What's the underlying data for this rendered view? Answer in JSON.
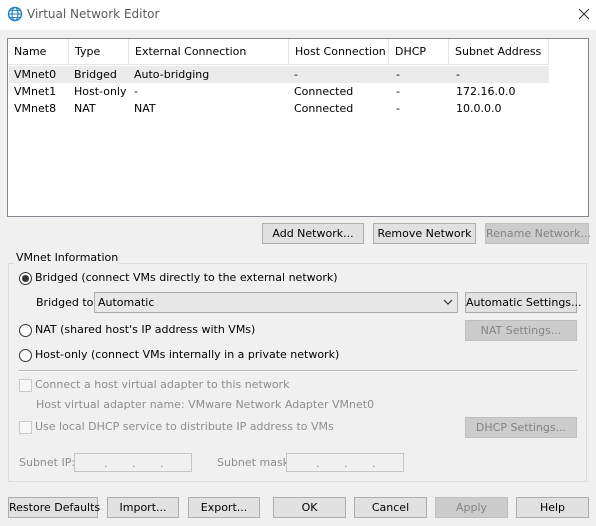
{
  "window": {
    "title": "Virtual Network Editor",
    "icon": "globe-icon",
    "close_icon": "close-icon"
  },
  "network_table": {
    "columns": [
      "Name",
      "Type",
      "External Connection",
      "Host Connection",
      "DHCP",
      "Subnet Address"
    ],
    "rows": [
      {
        "name": "VMnet0",
        "type": "Bridged",
        "external": "Auto-bridging",
        "host": "-",
        "dhcp": "-",
        "subnet": "-"
      },
      {
        "name": "VMnet1",
        "type": "Host-only",
        "external": "-",
        "host": "Connected",
        "dhcp": "-",
        "subnet": "172.16.0.0"
      },
      {
        "name": "VMnet8",
        "type": "NAT",
        "external": "NAT",
        "host": "Connected",
        "dhcp": "-",
        "subnet": "10.0.0.0"
      }
    ],
    "selected_row": 0
  },
  "network_buttons": {
    "add": "Add Network...",
    "remove": "Remove Network",
    "rename": "Rename Network..."
  },
  "vmnet_info": {
    "group_label": "VMnet Information",
    "bridged_label": "Bridged (connect VMs directly to the external network)",
    "bridged_to_label": "Bridged to:",
    "bridged_to_value": "Automatic",
    "automatic_settings": "Automatic Settings...",
    "nat_label": "NAT (shared host's IP address with VMs)",
    "nat_settings": "NAT Settings...",
    "host_only_label": "Host-only (connect VMs internally in a private network)",
    "connect_adapter_label": "Connect a host virtual adapter to this network",
    "adapter_name_label": "Host virtual adapter name: VMware Network Adapter VMnet0",
    "dhcp_label": "Use local DHCP service to distribute IP address to VMs",
    "dhcp_settings": "DHCP Settings...",
    "subnet_ip_label": "Subnet IP:",
    "subnet_mask_label": "Subnet mask:",
    "subnet_ip_value": " .  .  . ",
    "subnet_mask_value": " .  .  . ",
    "selected_mode": "bridged"
  },
  "footer_buttons": {
    "restore": "Restore Defaults",
    "import": "Import...",
    "export": "Export...",
    "ok": "OK",
    "cancel": "Cancel",
    "apply": "Apply",
    "help": "Help"
  },
  "colors": {
    "selected_row": "#ebebeb",
    "disabled_text": "#838383",
    "globe_icon": "#1a7fc1"
  }
}
